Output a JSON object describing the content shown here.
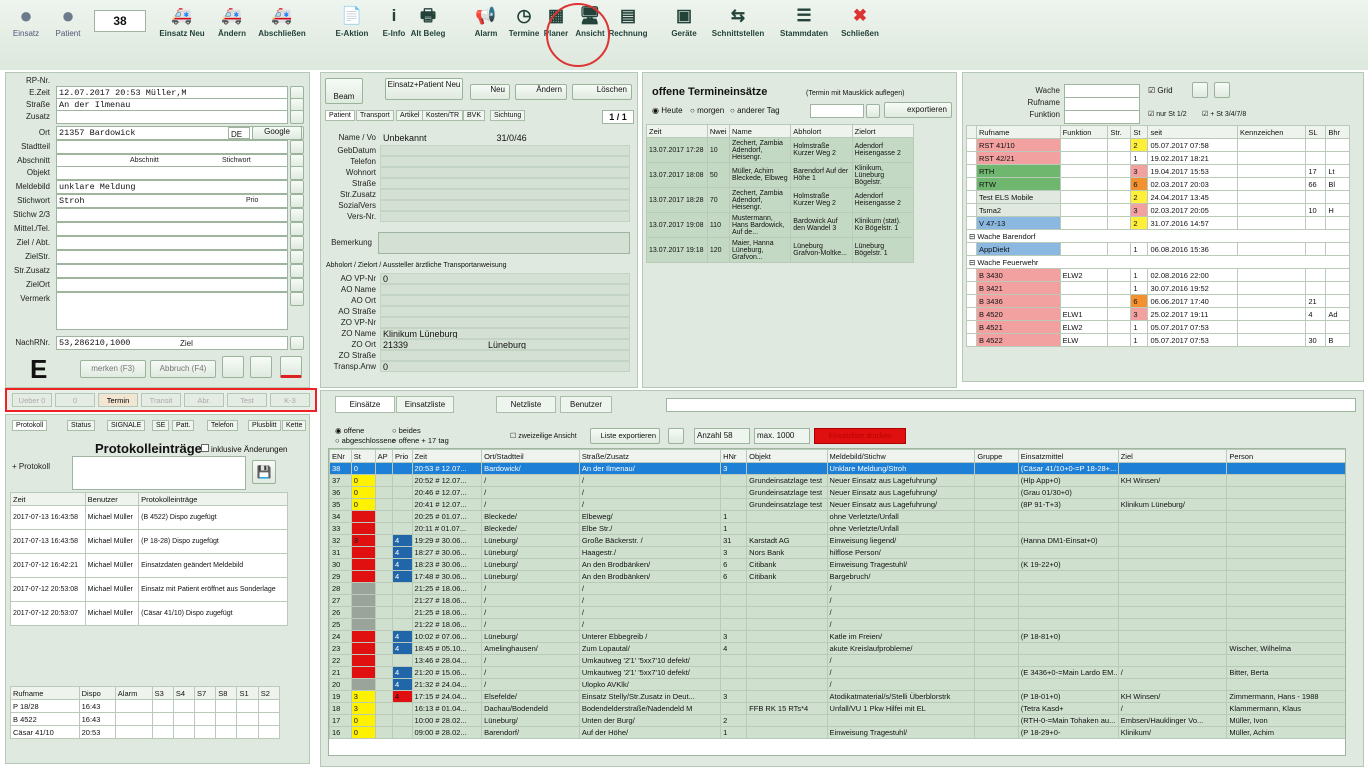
{
  "toolbar": {
    "counter": "38",
    "buttons": [
      {
        "id": "einsatz",
        "label": "Einsatz",
        "icon": "circle-e-icon"
      },
      {
        "id": "patient",
        "label": "Patient",
        "icon": "circle-p-icon"
      },
      {
        "id": "einsatz-neu",
        "label": "Einsatz Neu",
        "icon": "truck-plus-icon"
      },
      {
        "id": "aendern",
        "label": "Ändern",
        "icon": "truck-edit-icon"
      },
      {
        "id": "abschliessen",
        "label": "Abschließen",
        "icon": "truck-done-icon"
      },
      {
        "id": "e-aktion",
        "label": "E-Aktion",
        "icon": "document-icon"
      },
      {
        "id": "e-info",
        "label": "E-Info",
        "icon": "info-icon"
      },
      {
        "id": "alt-beleg",
        "label": "Alt Beleg",
        "icon": "printer-icon"
      },
      {
        "id": "alarm",
        "label": "Alarm",
        "icon": "horn-icon"
      },
      {
        "id": "termine",
        "label": "Termine",
        "icon": "clock-icon"
      },
      {
        "id": "planer",
        "label": "Planer",
        "icon": "calendar-icon"
      },
      {
        "id": "ansicht",
        "label": "Ansicht",
        "icon": "monitor-icon"
      },
      {
        "id": "rechnung",
        "label": "Rechnung",
        "icon": "invoice-icon"
      },
      {
        "id": "geraete",
        "label": "Geräte",
        "icon": "devices-icon"
      },
      {
        "id": "schnittstellen",
        "label": "Schnittstellen",
        "icon": "interface-icon"
      },
      {
        "id": "stammdaten",
        "label": "Stammdaten",
        "icon": "database-icon"
      },
      {
        "id": "schliessen",
        "label": "Schließen",
        "icon": "close-icon"
      }
    ]
  },
  "form": {
    "rp_label": "RP-Nr.",
    "ezeit_label": "E.Zeit",
    "ezeit_date": "12.07.2017",
    "ezeit_time": "20:53 Müller,M",
    "strasse_label": "Straße",
    "strasse_value": "An der Ilmenau",
    "zusatz_label": "Zusatz",
    "ort_label": "Ort",
    "ort_value": "21357  Bardowick",
    "ort_state": "DE",
    "ort_map": "Google",
    "stadtteil_label": "Stadtteil",
    "abschnitt_label": "Abschnitt",
    "stichwort_label": "Stichwort",
    "objekt_label": "Objekt",
    "meldebild_label": "Meldebild",
    "meldebild_value": "unklare Meldung",
    "stichwort2_label": "Stichwort",
    "stichwort2_value": "Stroh",
    "stichwort2_prio": "Prio",
    "stichw23_label": "Stichw 2/3",
    "mittel_label": "Mittel./Tel.",
    "ziel_label": "Ziel / Abt.",
    "zielstr_label": "ZielStr.",
    "zusatz2_label": "Str.Zusatz",
    "zielort_label": "ZielOrt",
    "vermerk_label": "Vermerk",
    "nachrnr_label": "NachRNr.",
    "nachrnr_value": "53,286210,1000",
    "nachrnr_ziel": "Ziel",
    "e_badge": "E",
    "merken_btn": "merken (F3)",
    "abbruch_btn": "Abbruch (F4)"
  },
  "status_tabs": [
    "Ueber 0",
    "0",
    "Termin",
    "Transit",
    "Abr.",
    "Test",
    "K-3"
  ],
  "protokoll": {
    "tabs": [
      "Protokoll",
      "Status",
      "SIGNALE",
      "SE",
      "Patt.",
      "Telefon",
      "Plusblitt",
      "Kette"
    ],
    "title": "Protokolleinträge",
    "checkbox": "inklusive Änderungen",
    "input_label": "+ Protokoll",
    "headers": [
      "Zeit",
      "Benutzer",
      "Protokolleinträge"
    ],
    "rows": [
      [
        "2017-07-13 16:43:58",
        "Michael Müller",
        "(B 4522) Dispo zugefügt"
      ],
      [
        "2017-07-13 16:43:58",
        "Michael Müller",
        "(P 18-28) Dispo zugefügt"
      ],
      [
        "2017-07-12 16:42:21",
        "Michael Müller",
        "Einsatzdaten geändert Meldebild"
      ],
      [
        "2017-07-12 20:53:08",
        "Michael Müller",
        "Einsatz mit Patient eröffnet aus Sonderlage"
      ],
      [
        "2017-07-12 20:53:07",
        "Michael Müller",
        "(Cäsar 41/10) Dispo zugefügt"
      ]
    ]
  },
  "dispo": {
    "headers": [
      "Rufname",
      "Dispo",
      "Alarm",
      "S3",
      "S4",
      "S7",
      "S8",
      "S1",
      "S2"
    ],
    "rows": [
      [
        "P 18/28",
        "16:43"
      ],
      [
        "B 4522",
        "16:43"
      ],
      [
        "Cäsar 41/10",
        "20:53"
      ]
    ]
  },
  "patient": {
    "btn_beam": "Beam",
    "btn_einsatz_patient": "Einsatz+Patient Neu",
    "btn_neu": "Neu",
    "btn_aendern": "Ändern",
    "btn_loeschen": "Löschen",
    "tabs": [
      "Patient",
      "Transport",
      "Artikel",
      "Kosten/TR",
      "BVK",
      "Sichtung"
    ],
    "pager": "1 / 1",
    "name_label": "Name / Vo",
    "name_value": "Unbekannt",
    "name_num": "31/0/46",
    "fields": [
      "GebDatum",
      "Telefon",
      "Wohnort",
      "Straße",
      "Str.Zusatz",
      "SozialVers",
      "Vers-Nr."
    ],
    "bemerkung_label": "Bemerkung",
    "abholort_header": "Abholort / Zielort / Aussteller ärztliche Transportanweisung",
    "ao_fields": [
      "AO VP-Nr",
      "AO Name",
      "AO Ort",
      "AO Straße",
      "ZO VP-Nr",
      "ZO Name",
      "ZO Ort",
      "ZO Straße",
      "Transp.Anw"
    ],
    "ao_vp_value": "0",
    "zo_name_value": "Klinikum Lüneburg",
    "zo_ort_value": "21339",
    "zo_ort_city": "Lüneburg",
    "transp_value": "0"
  },
  "termine": {
    "title": "offene Termineinsätze",
    "subtitle": "(Termin mit Mausklick auflegen)",
    "radios": [
      "Heute",
      "morgen",
      "anderer Tag"
    ],
    "export_btn": "exportieren",
    "headers": [
      "Zeit",
      "Nwei",
      "Name",
      "Abholort",
      "Zielort"
    ],
    "rows": [
      [
        "13.07.2017 17:28",
        "10",
        "Zechert, Zambia Adendorf, Heisengr.",
        "Holmstraße Kurzer Weg 2",
        "Adendorf Heisengasse 2"
      ],
      [
        "13.07.2017 18:08",
        "50",
        "Müller, Achim Bleckede, Elbweg",
        "Barendorf Auf der Höhe 1",
        "Klinikum, Lüneburg Bögelstr."
      ],
      [
        "13.07.2017 18:28",
        "70",
        "Zechert, Zambia Adendorf, Heisengr.",
        "Holmstraße Kurzer Weg 2",
        "Adendorf Heisengasse 2"
      ],
      [
        "13.07.2017 19:08",
        "110",
        "Mustermann, Hans Bardowick, Auf de...",
        "Bardowick Auf den Wandel 3",
        "Klinikum (stat). Ko Bögelstr. 1"
      ],
      [
        "13.07.2017 19:18",
        "120",
        "Maier, Hanna Lüneburg, Grafvon...",
        "Lüneburg Grafvon-Moltke...",
        "Lüneburg Bögelstr. 1"
      ]
    ]
  },
  "wachen": {
    "wache_label": "Wache",
    "rufname_label": "Rufname",
    "funktion_label": "Funktion",
    "grid_label": "Grid",
    "opt1": "nur St 1/2",
    "opt2": "+ St 3/4/7/8",
    "headers": [
      "Rufname",
      "Funktion",
      "Str.",
      "St",
      "seit",
      "Kennzeichen",
      "SL",
      "Bhr"
    ],
    "rows": [
      {
        "name": "RST 41/10",
        "func": "",
        "st": "2",
        "seit": "05.07.2017 07:58",
        "kz": "",
        "sl": "",
        "b": "",
        "color": "#f2a0a0",
        "stc": "#ffef3a"
      },
      {
        "name": "RST 42/21",
        "func": "",
        "st": "1",
        "seit": "19.02.2017 18:21",
        "kz": "",
        "sl": "",
        "b": "",
        "color": "#f2a0a0",
        "stc": ""
      },
      {
        "name": "RTH",
        "func": "",
        "st": "3",
        "seit": "19.04.2017 15:53",
        "kz": "",
        "sl": "17",
        "b": "Lt",
        "color": "#6fb76f",
        "stc": "#f3a0a0"
      },
      {
        "name": "RTW",
        "func": "",
        "st": "6",
        "seit": "02.03.2017 20:03",
        "kz": "",
        "sl": "66",
        "b": "Bl",
        "color": "#6fb76f",
        "stc": "#f39030"
      },
      {
        "name": "Test ELS Mobile",
        "func": "",
        "st": "2",
        "seit": "24.04.2017 13:45",
        "kz": "",
        "sl": "",
        "b": "",
        "color": "#e0e8e0",
        "stc": "#ffef3a"
      },
      {
        "name": "Tsma2",
        "func": "",
        "st": "3",
        "seit": "02.03.2017 20:05",
        "kz": "",
        "sl": "10",
        "b": "H",
        "color": "#e0e8e0",
        "stc": "#f3a0a0"
      },
      {
        "name": "V 47-13",
        "func": "",
        "st": "2",
        "seit": "31.07.2016 14:57",
        "kz": "",
        "sl": "",
        "b": "",
        "color": "#8ab8e0",
        "stc": "#ffef3a"
      }
    ],
    "group1": "Wache Barendorf",
    "group1_rows": [
      {
        "name": "AppDiekt",
        "func": "",
        "st": "1",
        "seit": "06.08.2016 15:36",
        "kz": "",
        "sl": "",
        "b": "",
        "color": "#8ab8e0",
        "stc": ""
      }
    ],
    "group2": "Wache Feuerwehr",
    "group2_rows": [
      {
        "name": "B 3430",
        "func": "ELW2",
        "st": "1",
        "seit": "02.08.2016 22:00",
        "kz": "",
        "sl": "",
        "b": "",
        "color": "#f2a0a0",
        "stc": ""
      },
      {
        "name": "B 3421",
        "func": "",
        "st": "1",
        "seit": "30.07.2016 19:52",
        "kz": "",
        "sl": "",
        "b": "",
        "color": "#f2a0a0",
        "stc": ""
      },
      {
        "name": "B 3436",
        "func": "",
        "st": "6",
        "seit": "06.06.2017 17:40",
        "kz": "",
        "sl": "21",
        "b": "",
        "color": "#f2a0a0",
        "stc": "#f39030"
      },
      {
        "name": "B 4520",
        "func": "ELW1",
        "st": "3",
        "seit": "25.02.2017 19:11",
        "kz": "",
        "sl": "4",
        "b": "Ad",
        "color": "#f2a0a0",
        "stc": "#f3a0a0"
      },
      {
        "name": "B 4521",
        "func": "ELW2",
        "st": "1",
        "seit": "05.07.2017 07:53",
        "kz": "",
        "sl": "",
        "b": "",
        "color": "#f2a0a0",
        "stc": ""
      },
      {
        "name": "B 4522",
        "func": "ELW",
        "st": "1",
        "seit": "05.07.2017 07:53",
        "kz": "",
        "sl": "30",
        "b": "B",
        "color": "#f2a0a0",
        "stc": ""
      }
    ]
  },
  "einsaetze": {
    "tabs": [
      "Einsätze",
      "Einsatzliste",
      "Netzliste",
      "Benutzer"
    ],
    "radios": [
      "offene",
      "abgeschlossene",
      "beides",
      "offene + 17 tag"
    ],
    "zweizeilig": "zweizeilige Ansicht",
    "liste_btn": "Liste exportieren",
    "anzahl_label": "Anzahl",
    "anzahl_value": "58",
    "max_label": "max.",
    "max_value": "1000",
    "red_btn": "Einsatzliste drucken",
    "headers": [
      "ENr",
      "St",
      "AP",
      "Prio",
      "Zeit",
      "Ort/Stadtteil",
      "Straße/Zusatz",
      "HNr",
      "Objekt",
      "Meldebild/Stichw",
      "Gruppe",
      "Einsatzmittel",
      "Ziel",
      "Person"
    ],
    "rows": [
      [
        "38",
        "0",
        "",
        "",
        "20:53 # 12.07...",
        "Bardowick/",
        "An der Ilmenau/",
        "3",
        "",
        "Unklare Meldung/Stroh",
        "",
        "(Cäsar 41/10+0-=P 18-28+...",
        "",
        ""
      ],
      [
        "37",
        "0",
        "",
        "",
        "20:52 # 12.07...",
        "/",
        "/",
        "",
        "Grundeinsatzlage test",
        "Neuer Einsatz aus Lagefuhrung/",
        "",
        "(Hlp App+0)",
        "KH Winsen/",
        ""
      ],
      [
        "36",
        "0",
        "",
        "",
        "20:46 # 12.07...",
        "/",
        "/",
        "",
        "Grundeinsatzlage test",
        "Neuer Einsatz aus Lagefuhrung/",
        "",
        "(Grau 01/30+0)",
        "",
        ""
      ],
      [
        "35",
        "0",
        "",
        "",
        "20:41 # 12.07...",
        "/",
        "/",
        "",
        "Grundeinsatzlage test",
        "Neuer Einsatz aus Lagefuhrung/",
        "",
        "(8P 91-T+3)",
        "Klinikum Lüneburg/",
        ""
      ],
      [
        "34",
        "",
        "",
        "",
        "20:25 # 01.07...",
        "Bleckede/",
        "Elbeweg/",
        "1",
        "",
        "ohne Verletzte/Unfall",
        "",
        "",
        "",
        ""
      ],
      [
        "33",
        "",
        "",
        "",
        "20:11 # 01.07...",
        "Bleckede/",
        "Elbe Str./",
        "1",
        "",
        "ohne Verletzte/Unfall",
        "",
        "",
        "",
        ""
      ],
      [
        "32",
        "3",
        "",
        "4",
        "19:29 # 30.06...",
        "Lüneburg/",
        "Große Bäckerstr. /",
        "31",
        "Karstadt AG",
        "Einweisung liegend/",
        "",
        "(Hanna DM1-Einsat+0)",
        "",
        ""
      ],
      [
        "31",
        "",
        "",
        "4",
        "18:27 # 30.06...",
        "Lüneburg/",
        "Haagestr./",
        "3",
        "Nors Bank",
        "hilflose Person/",
        "",
        "",
        "",
        ""
      ],
      [
        "30",
        "",
        "",
        "4",
        "18:23 # 30.06...",
        "Lüneburg/",
        "An den Brodbänken/",
        "6",
        "Citibank",
        "Einweisung Tragestuhl/",
        "",
        "(K 19-22+0)",
        "",
        ""
      ],
      [
        "29",
        "",
        "",
        "4",
        "17:48 # 30.06...",
        "Lüneburg/",
        "An den Brodbänken/",
        "6",
        "Citibank",
        "Bargebruch/",
        "",
        "",
        "",
        ""
      ],
      [
        "28",
        "",
        "",
        "",
        "21:25 # 18.06...",
        "/",
        "/",
        "",
        "",
        "/",
        "",
        "",
        "",
        ""
      ],
      [
        "27",
        "",
        "",
        "",
        "21:27 # 18.06...",
        "/",
        "/",
        "",
        "",
        "/",
        "",
        "",
        "",
        ""
      ],
      [
        "26",
        "",
        "",
        "",
        "21:25 # 18.06...",
        "/",
        "/",
        "",
        "",
        "/",
        "",
        "",
        "",
        ""
      ],
      [
        "25",
        "",
        "",
        "",
        "21:22 # 18.06...",
        "/",
        "/",
        "",
        "",
        "/",
        "",
        "",
        "",
        ""
      ],
      [
        "24",
        "",
        "",
        "4",
        "10:02 # 07.06...",
        "Lüneburg/",
        "Unterer Ebbegreib /",
        "3",
        "",
        "Katle im Freien/",
        "",
        "(P 18-81+0)",
        "",
        ""
      ],
      [
        "23",
        "",
        "",
        "4",
        "18:45 # 05.10...",
        "Amelinghausen/",
        "Zum Lopautal/",
        "4",
        "",
        "akute Kreislaufprobleme/",
        "",
        "",
        "",
        "Wischer, Wilhelma"
      ],
      [
        "22",
        "",
        "",
        "",
        "13:46 # 28.04...",
        "/",
        "Umkautweg '2'1' '5xx7'10 defekt/",
        "",
        "",
        "/",
        "",
        "",
        "",
        ""
      ],
      [
        "21",
        "",
        "",
        "4",
        "21:20 # 15.06...",
        "/",
        "Umkautweg '2'1' '5xx7'10 defekt/",
        "",
        "",
        "/",
        "",
        "(E 3436+0-=Main Lardo EM...",
        "/",
        "Bitter, Berta"
      ],
      [
        "20",
        "",
        "",
        "4",
        "21:32 # 24.04...",
        "/",
        "Ulopko AVKlk/",
        "",
        "",
        "/",
        "",
        "",
        "",
        ""
      ],
      [
        "19",
        "3",
        "",
        "4",
        "17:15 # 24.04...",
        "Elsefelde/",
        "Einsatz Stelly/Str.Zusatz in Deut...",
        "3",
        "",
        "Atodikatmaterial/s/Stelli Überblorstrk",
        "",
        "(P 18-01+0)",
        "KH Winsen/",
        "Zimmermann, Hans - 1988"
      ],
      [
        "18",
        "3",
        "",
        "",
        "16:13 # 01.04...",
        "Dachau/Bodendeld",
        "Bodendelderstraße/Nadendeld M",
        "",
        "FFB RK 15 RTs*4",
        "Unfall/VU 1 Pkw Hilfei mit EL",
        "",
        "(Tetra Kasd+",
        "/",
        "Klammermann, Klaus"
      ],
      [
        "17",
        "0",
        "",
        "",
        "10:00 # 28.02...",
        "Lüneburg/",
        "Unten der Burg/",
        "2",
        "",
        "",
        "",
        "(RTH-0-=Main Tohaken au...",
        "Embsen/Hauklinger Vo...",
        "Müller, Ivon"
      ],
      [
        "16",
        "0",
        "",
        "",
        "09:00 # 28.02...",
        "Barendorf/",
        "Auf der Höhe/",
        "1",
        "",
        "Einweisung Tragestuhl/",
        "",
        "(P 18-29+0-",
        "Klinikum/",
        "Müller, Achim"
      ]
    ],
    "row_colors": [
      "sel",
      "yellow",
      "yellow",
      "yellow",
      "red",
      "red",
      "red",
      "red",
      "red",
      "red",
      "red",
      "red",
      "red",
      "red",
      "red",
      "red",
      "red",
      "red",
      "red",
      "yellow",
      "yellow",
      "yellow",
      "yellow"
    ]
  },
  "colors": {
    "accent": "#1d7fd6",
    "panel": "#dfe9df",
    "grid": "#cfe0cf",
    "red": "#e01010",
    "yellow": "#fff200",
    "highlight": "#d33"
  }
}
